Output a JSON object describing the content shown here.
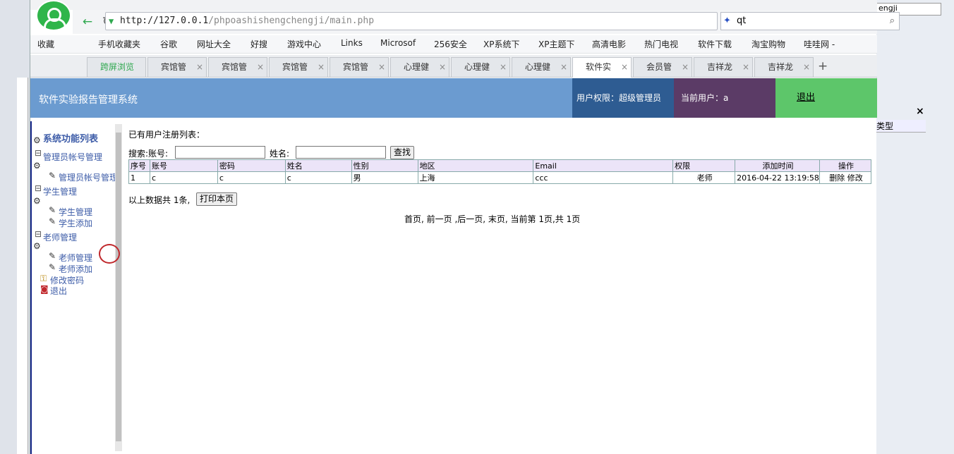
{
  "browser": {
    "url_host": "http://127.0.0.1",
    "url_path": "/phpoashishengchengji/main.php",
    "search_value": "qt"
  },
  "bookmarks": [
    "收藏",
    "手机收藏夹",
    "谷歌",
    "网址大全",
    "好搜",
    "游戏中心",
    "Links",
    "Microsof",
    "256安全",
    "XP系统下",
    "XP主题下",
    "高清电影",
    "热门电视",
    "软件下载",
    "淘宝购物",
    "哇哇网 -"
  ],
  "tabs": [
    "跨屏浏览",
    "宾馆管",
    "宾馆管",
    "宾馆管",
    "宾馆管",
    "心理健",
    "心理健",
    "心理健",
    "软件实",
    "会员管",
    "吉祥龙",
    "吉祥龙"
  ],
  "header": {
    "title": "软件实验报告管理系统",
    "permission": "用户权限：超级管理员",
    "current_user": "当前用户：a",
    "logout": "退出"
  },
  "sidebar": {
    "title": "系统功能列表",
    "groups": [
      {
        "label": "管理员帐号管理",
        "items": [
          "管理员帐号管理"
        ]
      },
      {
        "label": "学生管理",
        "items": [
          "学生管理",
          "学生添加"
        ]
      },
      {
        "label": "老师管理",
        "items": [
          "老师管理",
          "老师添加"
        ]
      }
    ],
    "change_password": "修改密码",
    "exit": "退出"
  },
  "content": {
    "heading": "已有用户注册列表：",
    "search_label": "搜索:账号:",
    "name_label": "姓名:",
    "search_button": "查找",
    "columns": [
      "序号",
      "账号",
      "密码",
      "姓名",
      "性别",
      "地区",
      "Email",
      "权限",
      "添加时间",
      "操作"
    ],
    "rows": [
      {
        "no": "1",
        "account": "c",
        "password": "c",
        "name": "c",
        "gender": "男",
        "region": "上海",
        "email": "ccc",
        "role": "老师",
        "time": "2016-04-22 13:19:58",
        "delete": "删除",
        "edit": "修改"
      }
    ],
    "summary": "以上数据共 1条,",
    "print_button": "打印本页",
    "pagination": "首页, 前一页 ,后一页, 末页, 当前第 1页,共 1页"
  },
  "right_panel": {
    "text": "engji",
    "type_label": "类型"
  }
}
